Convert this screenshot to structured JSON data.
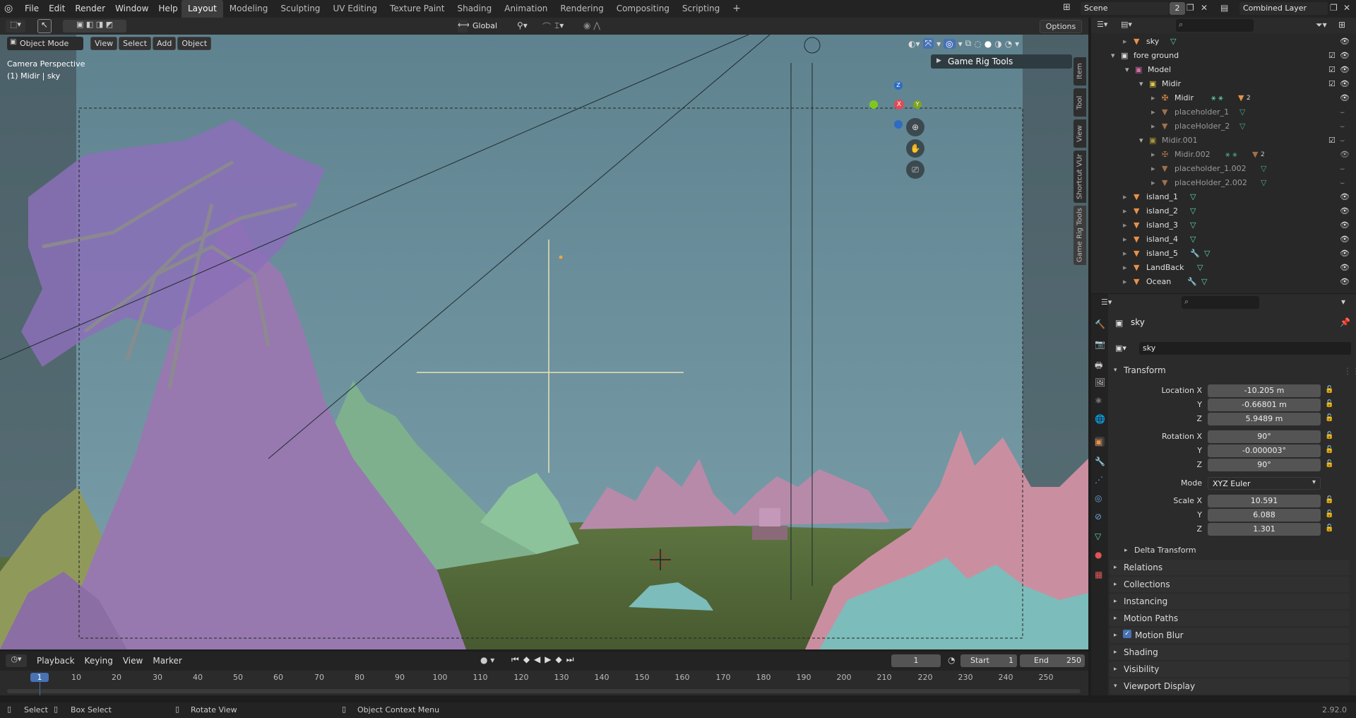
{
  "menu": [
    "File",
    "Edit",
    "Render",
    "Window",
    "Help"
  ],
  "workspaces": [
    "Layout",
    "Modeling",
    "Sculpting",
    "UV Editing",
    "Texture Paint",
    "Shading",
    "Animation",
    "Rendering",
    "Compositing",
    "Scripting"
  ],
  "scene": {
    "name": "Scene",
    "count": "2"
  },
  "view_layer": "Combined Layer",
  "header": {
    "transform": "Global",
    "options": "Options"
  },
  "viewport": {
    "mode": "Object Mode",
    "menus": [
      "View",
      "Select",
      "Add",
      "Object"
    ],
    "camera_label": "Camera Perspective",
    "object_label": "(1) Midir | sky",
    "panel_title": "Game Rig Tools",
    "side_tabs": [
      "Item",
      "Tool",
      "View",
      "Shortcut VUr",
      "Game Rig Tools"
    ],
    "gizmo": {
      "x": "X",
      "y": "Y",
      "z": "Z"
    }
  },
  "outliner": {
    "rows": [
      {
        "name": "sky",
        "type": "mesh"
      },
      {
        "name": "fore ground",
        "type": "collection"
      },
      {
        "name": "Model",
        "type": "collection"
      },
      {
        "name": "Midir",
        "type": "collection"
      },
      {
        "name": "Midir",
        "type": "armature"
      },
      {
        "name": "placeholder_1",
        "type": "mesh"
      },
      {
        "name": "placeHolder_2",
        "type": "mesh"
      },
      {
        "name": "Midir.001",
        "type": "collection"
      },
      {
        "name": "Midir.002",
        "type": "armature"
      },
      {
        "name": "placeholder_1.002",
        "type": "mesh"
      },
      {
        "name": "placeHolder_2.002",
        "type": "mesh"
      },
      {
        "name": "island_1",
        "type": "mesh"
      },
      {
        "name": "island_2",
        "type": "mesh"
      },
      {
        "name": "island_3",
        "type": "mesh"
      },
      {
        "name": "island_4",
        "type": "mesh"
      },
      {
        "name": "island_5",
        "type": "mesh"
      },
      {
        "name": "LandBack",
        "type": "mesh"
      },
      {
        "name": "Ocean",
        "type": "mesh"
      }
    ],
    "badge": "2"
  },
  "properties": {
    "object_name": "sky",
    "object_field": "sky",
    "transform_title": "Transform",
    "location_label": "Location X",
    "location": [
      "-10.205 m",
      "-0.66801 m",
      "5.9489 m"
    ],
    "rotation_label": "Rotation X",
    "rotation": [
      "90°",
      "-0.000003°",
      "90°"
    ],
    "mode_label": "Mode",
    "mode_value": "XYZ Euler",
    "scale_label": "Scale X",
    "scale": [
      "10.591",
      "6.088",
      "1.301"
    ],
    "axis_y": "Y",
    "axis_z": "Z",
    "delta_transform": "Delta Transform",
    "sections": [
      "Relations",
      "Collections",
      "Instancing",
      "Motion Paths",
      "Motion Blur",
      "Shading",
      "Visibility",
      "Viewport Display"
    ]
  },
  "timeline": {
    "menus": [
      "Playback",
      "Keying",
      "View",
      "Marker"
    ],
    "current_frame": "1",
    "start_label": "Start",
    "start": "1",
    "end_label": "End",
    "end": "250",
    "ticks": [
      "1",
      "10",
      "20",
      "30",
      "40",
      "50",
      "60",
      "70",
      "80",
      "90",
      "100",
      "110",
      "120",
      "130",
      "140",
      "150",
      "160",
      "170",
      "180",
      "190",
      "200",
      "210",
      "220",
      "230",
      "240",
      "250"
    ]
  },
  "status": {
    "select": "Select",
    "box_select": "Box Select",
    "rotate": "Rotate View",
    "context_menu": "Object Context Menu",
    "version": "2.92.0"
  },
  "colors": {
    "accent": "#4772b3",
    "sky": "#6e93a0",
    "ground": "#5a6d3c",
    "purple_mountain": "#9879b0",
    "green_mountain": "#84b98f",
    "pink_mountain": "#c4879a",
    "teal_mountain": "#7cbcba"
  }
}
